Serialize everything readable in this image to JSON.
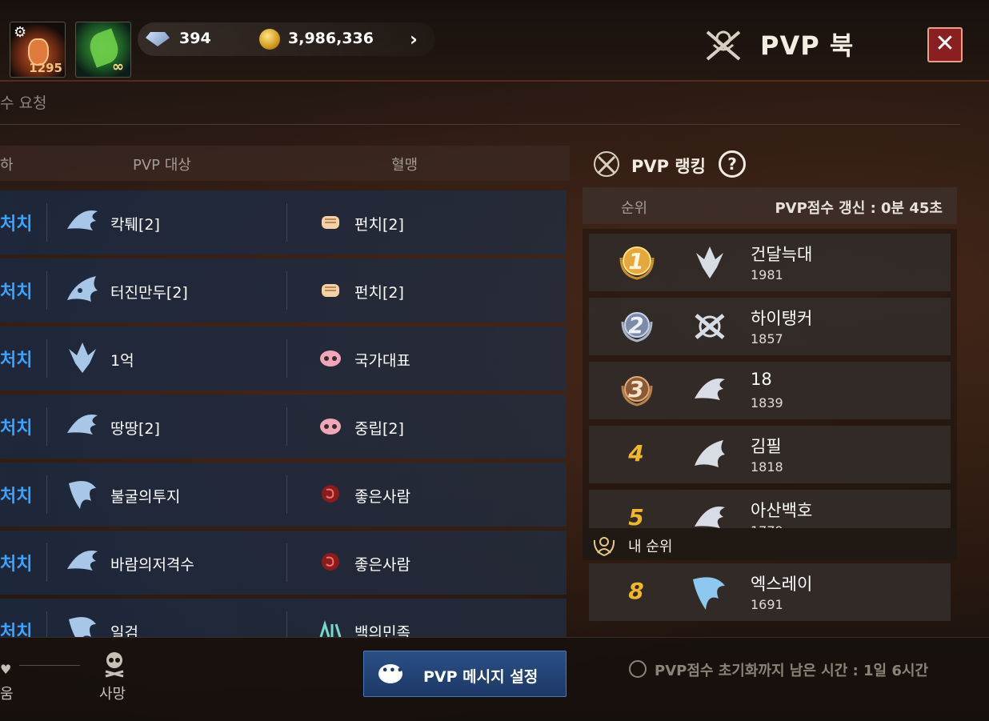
{
  "header": {
    "potion_count": "1295",
    "leaf_badge": "∞",
    "gems": "394",
    "gold": "3,986,336",
    "title": "PVP 북",
    "close_label": "✕"
  },
  "subtab": {
    "label": "수 요청"
  },
  "list": {
    "columns": [
      "하",
      "PVP 대상",
      "혈맹"
    ],
    "rows": [
      {
        "action": "처치",
        "target": "칵퉤[2]",
        "class_icon": "wing-icon",
        "guild_icon": "fist-icon",
        "guild": "펀치[2]"
      },
      {
        "action": "처치",
        "target": "터진만두[2]",
        "class_icon": "dragon-icon",
        "guild_icon": "fist-icon",
        "guild": "펀치[2]"
      },
      {
        "action": "처치",
        "target": "1억",
        "class_icon": "crystal-icon",
        "guild_icon": "panda-icon",
        "guild": "국가대표"
      },
      {
        "action": "처치",
        "target": "땅땅[2]",
        "class_icon": "wing-icon",
        "guild_icon": "panda-icon",
        "guild": "중립[2]"
      },
      {
        "action": "처치",
        "target": "불굴의투지",
        "class_icon": "blade-icon",
        "guild_icon": "scorpion-icon",
        "guild": "좋은사람"
      },
      {
        "action": "처치",
        "target": "바람의저격수",
        "class_icon": "wing-icon",
        "guild_icon": "scorpion-icon",
        "guild": "좋은사람"
      },
      {
        "action": "처치",
        "target": "일검",
        "class_icon": "blade-icon",
        "guild_icon": "text-emblem-icon",
        "guild": "백의민족"
      }
    ]
  },
  "ranking": {
    "title": "PVP 랭킹",
    "help": "?",
    "col_rank": "순위",
    "refresh": "PVP점수 갱신 : 0분 45초",
    "entries": [
      {
        "rank": "1",
        "name": "건달늑대",
        "score": "1981",
        "medal": "gold"
      },
      {
        "rank": "2",
        "name": "하이탱커",
        "score": "1857",
        "medal": "silver"
      },
      {
        "rank": "3",
        "name": "18",
        "score": "1839",
        "medal": "bronze"
      },
      {
        "rank": "4",
        "name": "김필",
        "score": "1818",
        "medal": "none"
      },
      {
        "rank": "5",
        "name": "아산백호",
        "score": "1779",
        "medal": "none"
      }
    ],
    "my_title": "내 순위",
    "mine": {
      "rank": "8",
      "name": "엑스레이",
      "score": "1691"
    }
  },
  "bottom": {
    "tab_left": "움",
    "tab_death": "사망",
    "message_button": "PVP 메시지 설정",
    "reset_timer": "PVP점수 초기화까지 남은 시간 : 1일 6시간"
  },
  "colors": {
    "accent_blue": "#3ba4ff",
    "rank_gold": "#f0b828",
    "close_red": "#8a1f1f"
  }
}
